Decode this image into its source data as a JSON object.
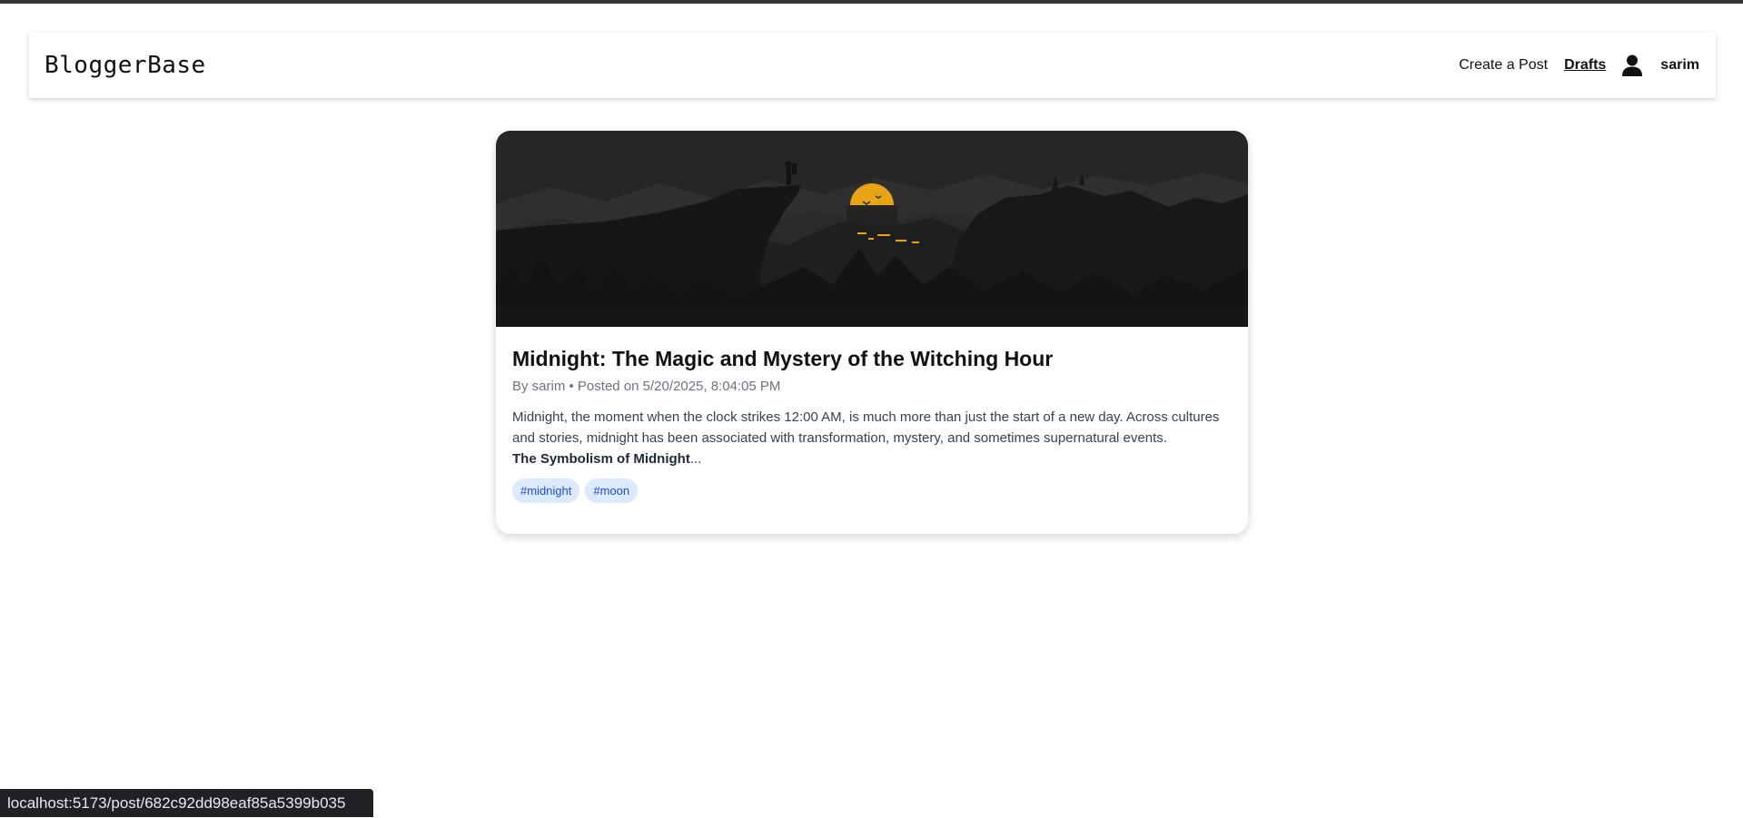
{
  "navbar": {
    "brand": "BloggerBase",
    "create_post": "Create a Post",
    "drafts": "Drafts",
    "username": "sarim",
    "user_icon": "user-icon"
  },
  "post": {
    "title": "Midnight: The Magic and Mystery of the Witching Hour",
    "meta": "By sarim • Posted on 5/20/2025, 8:04:05 PM",
    "excerpt": "Midnight, the moment when the clock strikes 12:00 AM, is much more than just the start of a new day. Across cultures and stories, midnight has been associated with transformation, mystery, and sometimes supernatural events.",
    "excerpt_heading": "The Symbolism of Midnight",
    "ellipsis": "...",
    "tags": [
      "#midnight",
      "#moon"
    ],
    "image_colors": {
      "sky": "#262626",
      "ground": "#151515",
      "moon": "#e8a317"
    }
  },
  "status_bar": {
    "url": "localhost:5173/post/682c92dd98eaf85a5399b035"
  }
}
